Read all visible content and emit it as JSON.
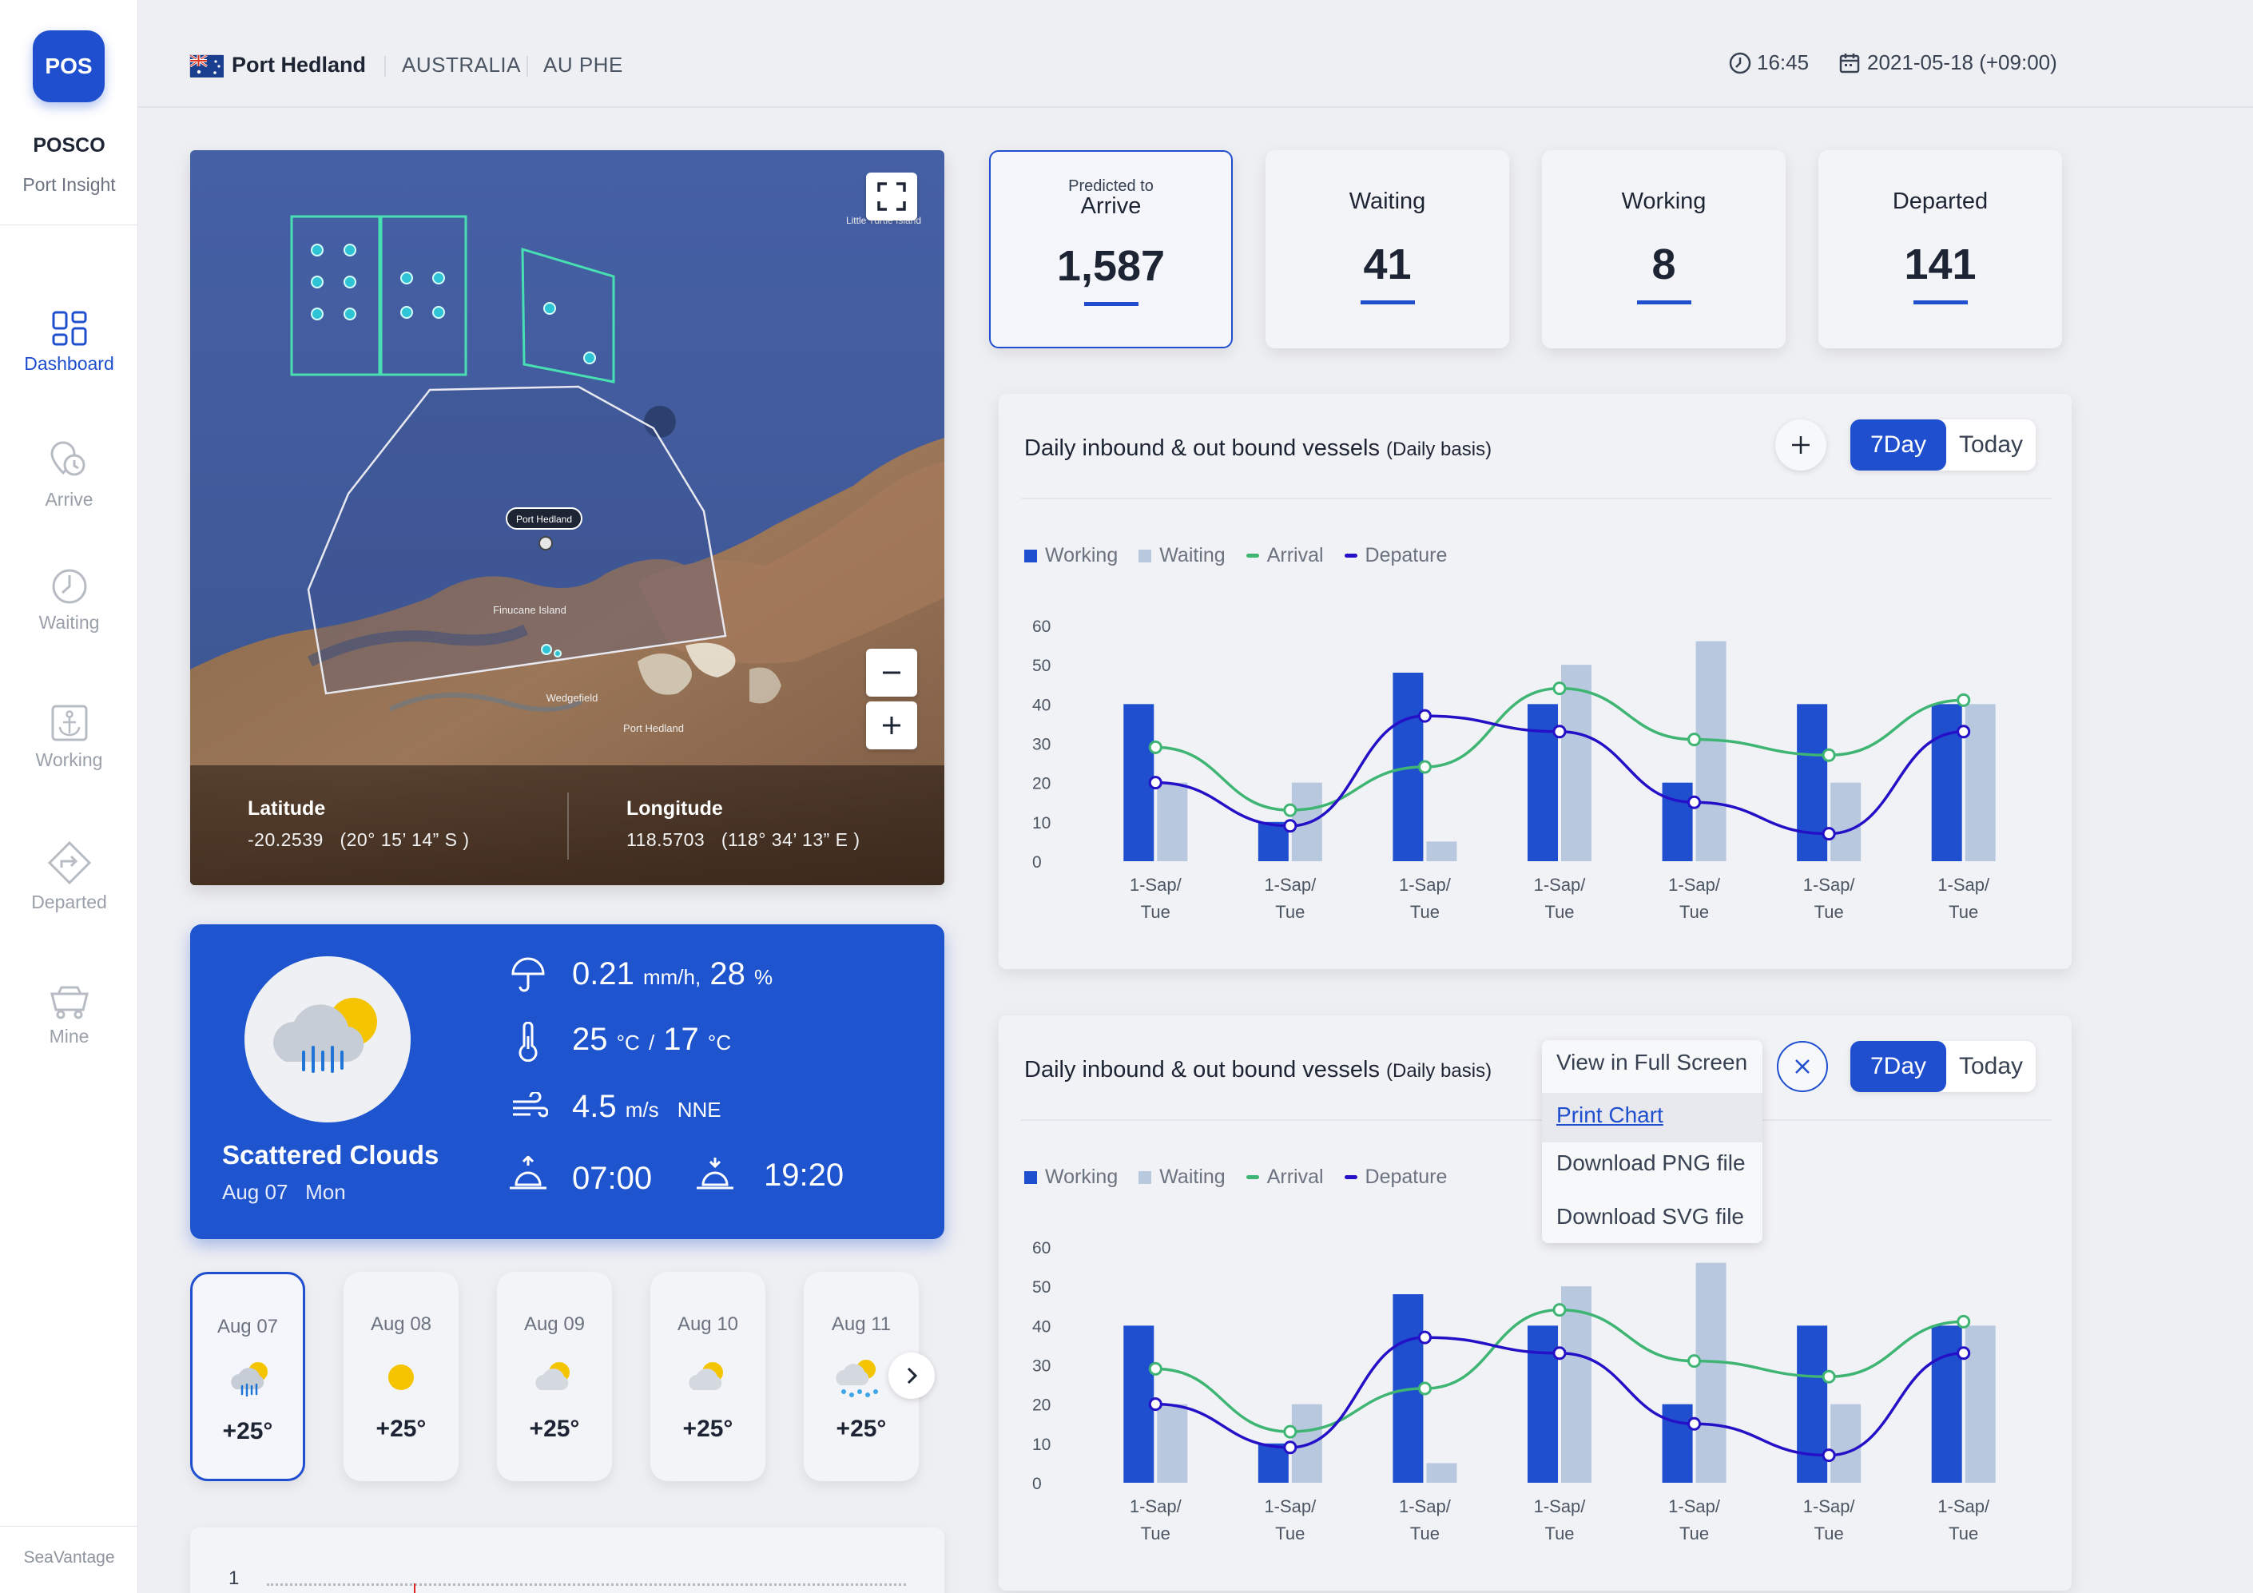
{
  "sidebar": {
    "logo": "POS",
    "brand": "POSCO",
    "brand_sub": "Port Insight",
    "items": [
      {
        "label": "Dashboard",
        "icon": "dashboard-icon"
      },
      {
        "label": "Arrive",
        "icon": "arrive-icon"
      },
      {
        "label": "Waiting",
        "icon": "waiting-icon"
      },
      {
        "label": "Working",
        "icon": "anchor-icon"
      },
      {
        "label": "Departed",
        "icon": "departed-icon"
      },
      {
        "label": "Mine",
        "icon": "mine-cart-icon"
      }
    ],
    "footer": "SeaVantage"
  },
  "header": {
    "city": "Port Hedland",
    "country": "AUSTRALIA",
    "code": "AU PHE",
    "time": "16:45",
    "date": "2021-05-18 (+09:00)"
  },
  "map": {
    "labels": {
      "port": "Port Hedland",
      "island": "Finucane Island",
      "town1": "Port Hedland",
      "town2": "Wedgefield",
      "corner": "Little Turtle Island"
    },
    "latitude_label": "Latitude",
    "latitude_value": "-20.2539   (20° 15’ 14” S )",
    "longitude_label": "Longitude",
    "longitude_value": "118.5703   (118° 34’ 13” E )"
  },
  "weather": {
    "condition": "Scattered Clouds",
    "date": "Aug 07   Mon",
    "rain": "0.21",
    "rain_unit": "mm/h,",
    "humidity": "28",
    "humidity_unit": "%",
    "temp_max": "25",
    "temp_min": "17",
    "temp_unit": "°C",
    "temp_sep": "/",
    "wind": "4.5",
    "wind_unit": "m/s",
    "wind_dir": "NNE",
    "sunrise": "07:00",
    "sunset": "19:20",
    "forecast": [
      {
        "date": "Aug 07",
        "temp": "+25°",
        "icon": "rain-cloud-icon"
      },
      {
        "date": "Aug 08",
        "temp": "+25°",
        "icon": "sun-icon"
      },
      {
        "date": "Aug 09",
        "temp": "+25°",
        "icon": "partly-cloudy-icon"
      },
      {
        "date": "Aug 10",
        "temp": "+25°",
        "icon": "partly-cloudy-icon"
      },
      {
        "date": "Aug 11",
        "temp": "+25°",
        "icon": "snow-cloud-icon"
      }
    ]
  },
  "stats": [
    {
      "small": "Predicted to",
      "title": "Arrive",
      "value": "1,587"
    },
    {
      "title": "Waiting",
      "value": "41"
    },
    {
      "title": "Working",
      "value": "8"
    },
    {
      "title": "Departed",
      "value": "141"
    }
  ],
  "bottom_panel": {
    "value": "1"
  },
  "charts_ui": {
    "title": "Daily inbound & out bound vessels",
    "title_small": "(Daily basis)",
    "btn_7day": "7Day",
    "btn_today": "Today",
    "menu": [
      "View in Full Screen",
      "Print Chart",
      "Download PNG file",
      "Download SVG file"
    ]
  },
  "chart_data": [
    {
      "type": "bar",
      "title": "Daily inbound & out bound vessels (Daily basis)",
      "categories": [
        "1-Sap/ Tue",
        "1-Sap/ Tue",
        "1-Sap/ Tue",
        "1-Sap/ Tue",
        "1-Sap/ Tue",
        "1-Sap/ Tue",
        "1-Sap/ Tue"
      ],
      "ylim": [
        0,
        60
      ],
      "yticks": [
        0,
        10,
        20,
        30,
        40,
        50,
        60
      ],
      "legend": "top-left",
      "series": [
        {
          "name": "Working",
          "type": "bar",
          "color": "#1f4fcf",
          "values": [
            40,
            10,
            48,
            40,
            20,
            40,
            40
          ]
        },
        {
          "name": "Waiting",
          "type": "bar",
          "color": "#b8c8df",
          "values": [
            20,
            20,
            5,
            50,
            56,
            20,
            40
          ]
        },
        {
          "name": "Arrival",
          "type": "line",
          "color": "#3fb574",
          "values": [
            29,
            13,
            24,
            44,
            31,
            27,
            41
          ]
        },
        {
          "name": "Depature",
          "type": "line",
          "color": "#2410c6",
          "values": [
            20,
            9,
            37,
            33,
            15,
            7,
            33
          ]
        }
      ]
    },
    {
      "type": "bar",
      "title": "Daily inbound & out bound vessels (Daily basis)",
      "categories": [
        "1-Sap/ Tue",
        "1-Sap/ Tue",
        "1-Sap/ Tue",
        "1-Sap/ Tue",
        "1-Sap/ Tue",
        "1-Sap/ Tue",
        "1-Sap/ Tue"
      ],
      "ylim": [
        0,
        60
      ],
      "yticks": [
        0,
        10,
        20,
        30,
        40,
        50,
        60
      ],
      "legend": "top-left",
      "series": [
        {
          "name": "Working",
          "type": "bar",
          "color": "#1f4fcf",
          "values": [
            40,
            10,
            48,
            40,
            20,
            40,
            40
          ]
        },
        {
          "name": "Waiting",
          "type": "bar",
          "color": "#b8c8df",
          "values": [
            20,
            20,
            5,
            50,
            56,
            20,
            40
          ]
        },
        {
          "name": "Arrival",
          "type": "line",
          "color": "#3fb574",
          "values": [
            29,
            13,
            24,
            44,
            31,
            27,
            41
          ]
        },
        {
          "name": "Depature",
          "type": "line",
          "color": "#2410c6",
          "values": [
            20,
            9,
            37,
            33,
            15,
            7,
            33
          ]
        }
      ]
    }
  ]
}
